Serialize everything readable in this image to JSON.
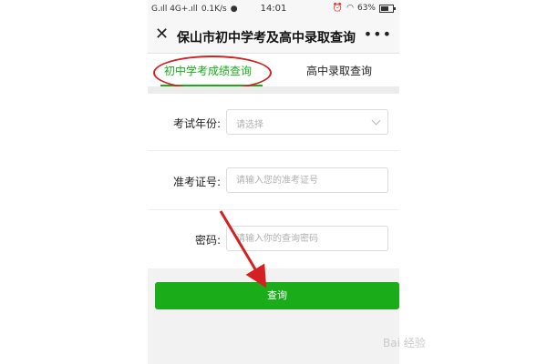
{
  "status_bar": {
    "network": "G.ıll 4G+.ıll",
    "speed": "0.1K/s",
    "time": "14:01",
    "battery": "63%",
    "battery_level": 0.63
  },
  "titlebar": {
    "title": "保山市初中学考及高中录取查询"
  },
  "tabs": [
    {
      "label": "初中学考成绩查询",
      "active": true
    },
    {
      "label": "高中录取查询",
      "active": false
    }
  ],
  "form": {
    "year": {
      "label": "考试年份:",
      "placeholder": "请选择"
    },
    "ticket": {
      "label": "准考证号:",
      "placeholder": "请输入您的准考证号"
    },
    "password": {
      "label": "密码:",
      "placeholder": "请输入你的查询密码"
    }
  },
  "button": {
    "label": "查询"
  },
  "watermark": "Bai 经验",
  "colors": {
    "accent": "#1aad19",
    "annotation": "#d42020"
  }
}
